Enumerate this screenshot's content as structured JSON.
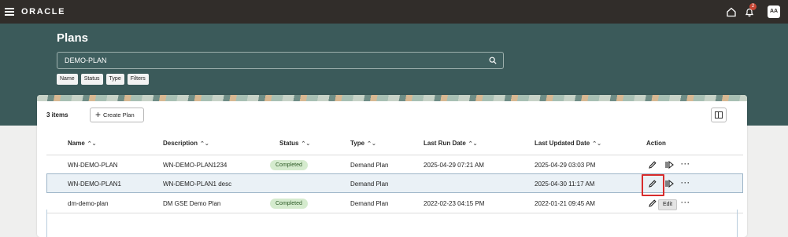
{
  "topbar": {
    "brand": "ORACLE",
    "notification_count": "2",
    "avatar_initials": "AA"
  },
  "page": {
    "title": "Plans"
  },
  "search": {
    "value": "DEMO-PLAN"
  },
  "filters": [
    "Name",
    "Status",
    "Type",
    "Filters"
  ],
  "toolbar": {
    "items_count": "3 items",
    "create_label": "Create Plan"
  },
  "table": {
    "columns": [
      "Name",
      "Description",
      "Status",
      "Type",
      "Last Run Date",
      "Last Updated Date",
      "Action"
    ],
    "rows": [
      {
        "name": "WN-DEMO-PLAN",
        "description": "WN-DEMO-PLAN1234",
        "status": "Completed",
        "type": "Demand Plan",
        "last_run": "2025-04-29 07:21 AM",
        "last_updated": "2025-04-29 03:03 PM"
      },
      {
        "name": "WN-DEMO-PLAN1",
        "description": "WN-DEMO-PLAN1 desc",
        "status": "",
        "type": "Demand Plan",
        "last_run": "",
        "last_updated": "2025-04-30 11:17 AM"
      },
      {
        "name": "dm-demo-plan",
        "description": "DM GSE Demo Plan",
        "status": "Completed",
        "type": "Demand Plan",
        "last_run": "2022-02-23 04:15 PM",
        "last_updated": "2022-01-21 09:45 AM"
      }
    ]
  },
  "tooltip": {
    "text": "Edit"
  },
  "colors": {
    "topbar": "#312d2a",
    "band": "#3b5a5a",
    "badge_bg": "#d5ebce",
    "highlight_row": "#eaf1f6",
    "focus_box": "#d82c2c"
  },
  "icons": [
    "hamburger-icon",
    "home-icon",
    "bell-icon",
    "search-icon",
    "plus-icon",
    "columns-icon",
    "sort-icon",
    "edit-icon",
    "run-icon",
    "more-icon"
  ]
}
